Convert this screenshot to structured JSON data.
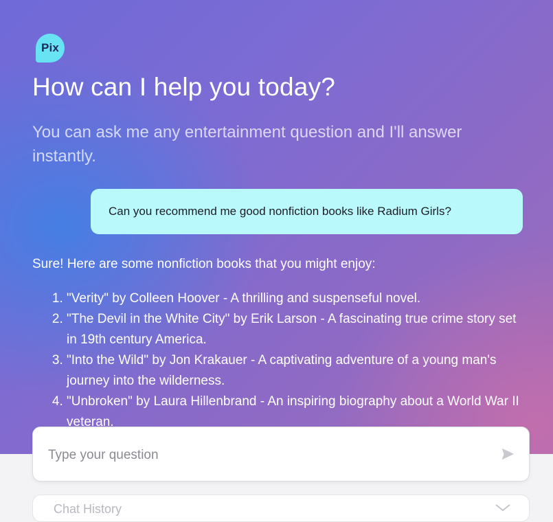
{
  "app": {
    "logo_text": "Pix"
  },
  "header": {
    "title": "How can I help you today?",
    "subtitle": "You can ask me any entertainment question and I'll answer instantly."
  },
  "chat": {
    "user_message": "Can you recommend me good nonfiction books like Radium Girls?",
    "assistant_intro": "Sure! Here are some nonfiction books that you might enjoy:",
    "assistant_items": [
      "\"Verity\" by Colleen Hoover - A thrilling and suspenseful novel.",
      "\"The Devil in the White City\" by Erik Larson - A fascinating true crime story set in 19th century America.",
      "\"Into the Wild\" by Jon Krakauer - A captivating adventure of a young man's journey into the wilderness.",
      "\"Unbroken\" by Laura Hillenbrand - An inspiring biography about a World War II veteran."
    ]
  },
  "input": {
    "placeholder": "Type your question",
    "send_icon": "send-icon"
  },
  "history": {
    "label": "Chat History",
    "toggle_icon": "chevron-down-icon"
  },
  "colors": {
    "user_bubble": "#baf9fb",
    "logo": "#67e3f3",
    "gradient_blue": "#3c82e6",
    "gradient_pink": "#c86eaa"
  }
}
